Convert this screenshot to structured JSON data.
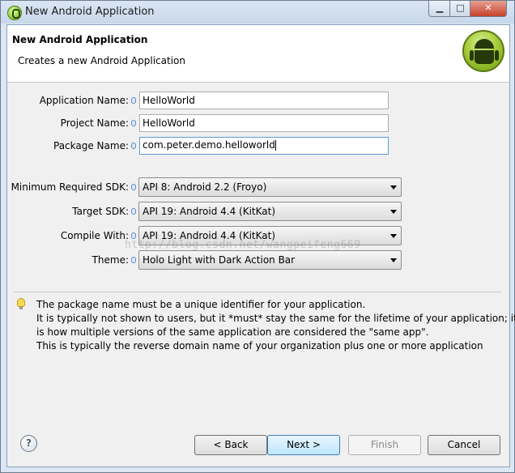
{
  "window": {
    "title": "New Android Application",
    "minimize_glyph": "▁",
    "maximize_glyph": "□",
    "close_glyph": "✕"
  },
  "header": {
    "title": "New Android Application",
    "description": "Creates a new Android Application"
  },
  "form": {
    "application_name": {
      "label": "Application Name:",
      "value": "HelloWorld"
    },
    "project_name": {
      "label": "Project Name:",
      "value": "HelloWorld"
    },
    "package_name": {
      "label": "Package Name:",
      "value": "com.peter.demo.helloworld"
    },
    "min_sdk": {
      "label": "Minimum Required SDK:",
      "value": "API 8: Android 2.2 (Froyo)"
    },
    "target_sdk": {
      "label": "Target SDK:",
      "value": "API 19: Android 4.4 (KitKat)"
    },
    "compile_with": {
      "label": "Compile With:",
      "value": "API 19: Android 4.4 (KitKat)"
    },
    "theme": {
      "label": "Theme:",
      "value": "Holo Light with Dark Action Bar"
    }
  },
  "watermark": "http://blog.csdn.net/wangpeifeng669",
  "help_message": {
    "lines": [
      "The package name must be a unique identifier for your application.",
      "It is typically not shown to users, but it *must* stay the same for the lifetime of your application; it",
      "is how multiple versions of the same application are considered the \"same app\".",
      "This is typically the reverse domain name of your organization plus one or more application"
    ]
  },
  "buttons": {
    "help": "?",
    "back": "< Back",
    "next": "Next >",
    "finish": "Finish",
    "cancel": "Cancel"
  }
}
